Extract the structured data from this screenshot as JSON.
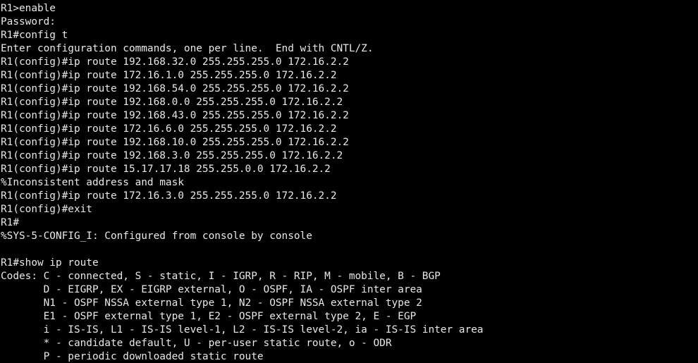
{
  "terminal": {
    "text_color": "#e8e8e8",
    "background_color": "#000000",
    "lines": [
      "R1>enable",
      "Password:",
      "R1#config t",
      "Enter configuration commands, one per line.  End with CNTL/Z.",
      "R1(config)#ip route 192.168.32.0 255.255.255.0 172.16.2.2",
      "R1(config)#ip route 172.16.1.0 255.255.255.0 172.16.2.2",
      "R1(config)#ip route 192.168.54.0 255.255.255.0 172.16.2.2",
      "R1(config)#ip route 192.168.0.0 255.255.255.0 172.16.2.2",
      "R1(config)#ip route 192.168.43.0 255.255.255.0 172.16.2.2",
      "R1(config)#ip route 172.16.6.0 255.255.255.0 172.16.2.2",
      "R1(config)#ip route 192.168.10.0 255.255.255.0 172.16.2.2",
      "R1(config)#ip route 192.168.3.0 255.255.255.0 172.16.2.2",
      "R1(config)#ip route 15.17.17.18 255.255.0.0 172.16.2.2",
      "%Inconsistent address and mask",
      "R1(config)#ip route 172.16.3.0 255.255.255.0 172.16.2.2",
      "R1(config)#exit",
      "R1#",
      "%SYS-5-CONFIG_I: Configured from console by console",
      "",
      "R1#show ip route",
      "Codes: C - connected, S - static, I - IGRP, R - RIP, M - mobile, B - BGP",
      "       D - EIGRP, EX - EIGRP external, O - OSPF, IA - OSPF inter area",
      "       N1 - OSPF NSSA external type 1, N2 - OSPF NSSA external type 2",
      "       E1 - OSPF external type 1, E2 - OSPF external type 2, E - EGP",
      "       i - IS-IS, L1 - IS-IS level-1, L2 - IS-IS level-2, ia - IS-IS inter area",
      "       * - candidate default, U - per-user static route, o - ODR",
      "       P - periodic downloaded static route"
    ]
  }
}
